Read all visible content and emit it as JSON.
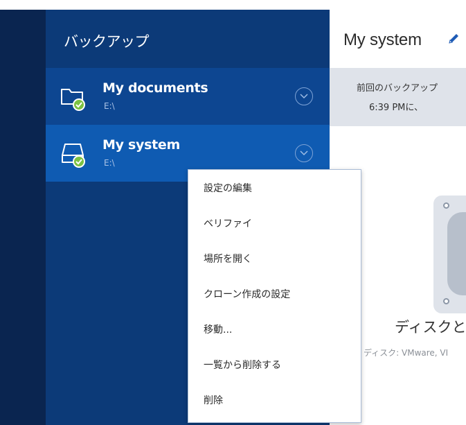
{
  "sidebar": {
    "title": "バックアップ",
    "items": [
      {
        "name": "My documents",
        "drive": "E:\\",
        "icon": "folder-icon",
        "status": "success-check-icon"
      },
      {
        "name": "My system",
        "drive": "E:\\",
        "icon": "drive-icon",
        "status": "success-check-icon"
      }
    ]
  },
  "main": {
    "title": "My system",
    "last_backup_label": "前回のバックアップ",
    "last_backup_time": "6:39 PMに、",
    "disk_caption": "ディスクと/",
    "disk_subcaption": "ディスク: VMware, VI"
  },
  "context_menu": {
    "items": [
      "設定の編集",
      "ベリファイ",
      "場所を開く",
      "クローン作成の設定",
      "移動...",
      "一覧から削除する",
      "削除"
    ]
  },
  "colors": {
    "nav_rail": "#0a2550",
    "panel": "#0c3a78",
    "item_docs": "#0d4691",
    "item_selected": "#0f5bb2",
    "success_green": "#7cc242"
  }
}
